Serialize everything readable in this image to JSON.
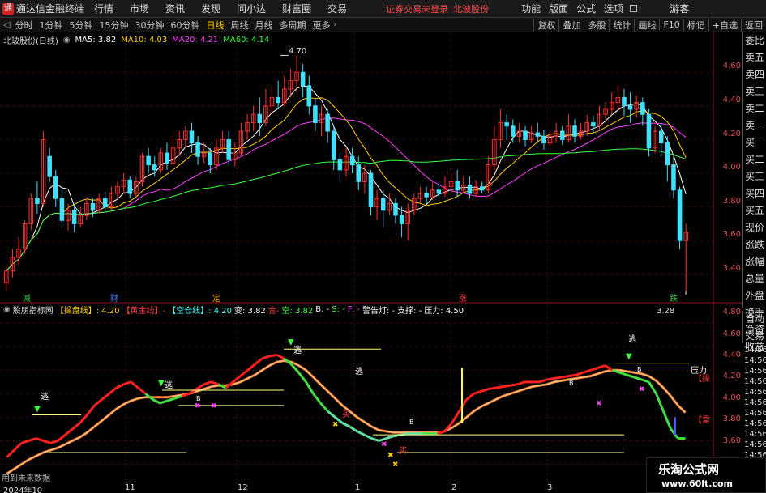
{
  "app": {
    "name": "通达信金融终端",
    "menus": [
      "行情",
      "市场",
      "资讯",
      "发现",
      "问小达",
      "财富圈",
      "交易"
    ],
    "login_notice": "证券交易未登录",
    "stock_name": "北玻股份",
    "right_menus": [
      "功能",
      "版面",
      "公式",
      "选项"
    ],
    "guest": "游客"
  },
  "toolbar": {
    "periods": [
      "分时",
      "1分钟",
      "5分钟",
      "15分钟",
      "30分钟",
      "60分钟",
      "日线",
      "周线",
      "月线",
      "多周期",
      "更多"
    ],
    "active_period": "日线",
    "right_buttons": [
      "复权",
      "叠加",
      "多股",
      "统计",
      "画线",
      "F10",
      "标记",
      "+自选",
      "返回"
    ]
  },
  "main_chart": {
    "title": "北玻股份(日线)",
    "ma_labels": [
      {
        "text": "MA5: 3.82",
        "color": "#ffffff"
      },
      {
        "text": "MA10: 4.03",
        "color": "#ffd000"
      },
      {
        "text": "MA20: 4.21",
        "color": "#ff40ff"
      },
      {
        "text": "MA60: 4.14",
        "color": "#40ff40"
      }
    ],
    "y_ticks": [
      "4.60",
      "4.40",
      "4.20",
      "4.00",
      "3.80",
      "3.60",
      "3.40"
    ],
    "high_label": "4.70",
    "low_label": "3.28",
    "markers": [
      {
        "text": "减",
        "color": "#40c040"
      },
      {
        "text": "财",
        "color": "#4080ff"
      },
      {
        "text": "定",
        "color": "#ffa000"
      },
      {
        "text": "涨",
        "color": "#ff4040"
      },
      {
        "text": "跌",
        "color": "#40c040"
      }
    ]
  },
  "right_panel": [
    "委比",
    "卖五",
    "卖四",
    "卖三",
    "卖二",
    "卖一",
    "买一",
    "买二",
    "买三",
    "买四",
    "买五",
    "现价",
    "涨跌",
    "涨幅",
    "总量",
    "外盘",
    "换手",
    "净资",
    "收益"
  ],
  "right_panel2": [
    "自动",
    "交易"
  ],
  "indicator": {
    "name": "股朋指标网",
    "labels": [
      {
        "text": "【操盘线】: 4.20",
        "color": "#ffd000"
      },
      {
        "text": "【黄金线】-",
        "color": "#ff4040"
      },
      {
        "text": "【空仓线】: 4.20",
        "color": "#40ffff"
      },
      {
        "text": "变: 3.82",
        "color": "#ffffff"
      },
      {
        "text": "金-",
        "color": "#ff4040"
      },
      {
        "text": "空: 3.82",
        "color": "#40ff40"
      },
      {
        "text": "B: -",
        "color": "#ffffff"
      },
      {
        "text": "S: -",
        "color": "#40ff40"
      },
      {
        "text": "F: -",
        "color": "#ff40ff"
      },
      {
        "text": "警告灯: -",
        "color": "#ffffff"
      },
      {
        "text": "支撑: -",
        "color": "#ffffff"
      },
      {
        "text": "压力: 4.50",
        "color": "#ffffff"
      }
    ],
    "y_ticks": [
      "4.80",
      "4.60",
      "4.40",
      "4.20",
      "4.00",
      "3.80",
      "3.60"
    ],
    "right_ticks": [
      "14:56",
      "14:56",
      "14:56",
      "14:56",
      "14:56",
      "14:56",
      "14:56",
      "14:56",
      "14:56",
      "14:56",
      "14:56",
      "14:56"
    ],
    "annotations": {
      "escape": "逃",
      "buy": "买",
      "pressure": "压力",
      "B": "B",
      "cut1": "【操",
      "cut2": "【雷"
    }
  },
  "x_axis": [
    "2024年10",
    "11",
    "12",
    "1",
    "2",
    "3"
  ],
  "no_future": "用到未来数据",
  "watermark": {
    "line1": "乐淘公式网",
    "line2": "www.60lt.com"
  },
  "chart_data": {
    "type": "candlestick",
    "title": "北玻股份(日线)",
    "ylim": [
      3.25,
      4.75
    ],
    "candles": [
      [
        3.35,
        3.42,
        3.3,
        3.45
      ],
      [
        3.42,
        3.5,
        3.38,
        3.55
      ],
      [
        3.5,
        3.55,
        3.46,
        3.62
      ],
      [
        3.55,
        3.7,
        3.52,
        3.72
      ],
      [
        3.7,
        3.85,
        3.66,
        3.88
      ],
      [
        3.85,
        3.82,
        3.76,
        3.95
      ],
      [
        3.82,
        4.2,
        3.8,
        4.25
      ],
      [
        4.1,
        3.98,
        3.95,
        4.15
      ],
      [
        3.98,
        3.85,
        3.8,
        4.02
      ],
      [
        3.85,
        3.72,
        3.68,
        3.9
      ],
      [
        3.72,
        3.78,
        3.66,
        3.82
      ],
      [
        3.78,
        3.7,
        3.65,
        3.82
      ],
      [
        3.7,
        3.75,
        3.68,
        3.8
      ],
      [
        3.75,
        3.82,
        3.72,
        3.86
      ],
      [
        3.82,
        3.78,
        3.74,
        3.85
      ],
      [
        3.78,
        3.85,
        3.76,
        3.88
      ],
      [
        3.85,
        3.8,
        3.77,
        3.89
      ],
      [
        3.8,
        3.88,
        3.78,
        3.92
      ],
      [
        3.88,
        3.92,
        3.85,
        3.95
      ],
      [
        3.92,
        3.96,
        3.88,
        4.0
      ],
      [
        3.96,
        3.88,
        3.85,
        3.98
      ],
      [
        3.88,
        3.95,
        3.86,
        3.98
      ],
      [
        3.95,
        4.1,
        3.92,
        4.12
      ],
      [
        4.1,
        4.05,
        4.0,
        4.15
      ],
      [
        4.05,
        4.02,
        3.98,
        4.1
      ],
      [
        4.02,
        4.12,
        4.0,
        4.15
      ],
      [
        4.12,
        4.06,
        4.02,
        4.18
      ],
      [
        4.06,
        4.15,
        4.04,
        4.2
      ],
      [
        4.15,
        4.2,
        4.1,
        4.25
      ],
      [
        4.2,
        4.25,
        4.15,
        4.28
      ],
      [
        4.25,
        4.18,
        4.12,
        4.3
      ],
      [
        4.18,
        4.1,
        4.05,
        4.22
      ],
      [
        4.1,
        4.12,
        4.06,
        4.18
      ],
      [
        4.12,
        4.05,
        4.0,
        4.15
      ],
      [
        4.05,
        4.15,
        4.02,
        4.2
      ],
      [
        4.15,
        4.2,
        4.12,
        4.25
      ],
      [
        4.2,
        4.08,
        4.05,
        4.25
      ],
      [
        4.08,
        4.12,
        4.04,
        4.18
      ],
      [
        4.12,
        4.25,
        4.1,
        4.3
      ],
      [
        4.25,
        4.3,
        4.2,
        4.35
      ],
      [
        4.3,
        4.35,
        4.25,
        4.4
      ],
      [
        4.35,
        4.3,
        4.22,
        4.45
      ],
      [
        4.3,
        4.4,
        4.28,
        4.5
      ],
      [
        4.4,
        4.45,
        4.35,
        4.52
      ],
      [
        4.45,
        4.42,
        4.38,
        4.55
      ],
      [
        4.42,
        4.5,
        4.4,
        4.58
      ],
      [
        4.5,
        4.55,
        4.45,
        4.62
      ],
      [
        4.55,
        4.6,
        4.48,
        4.7
      ],
      [
        4.6,
        4.52,
        4.45,
        4.65
      ],
      [
        4.52,
        4.4,
        4.35,
        4.58
      ],
      [
        4.4,
        4.3,
        4.25,
        4.45
      ],
      [
        4.3,
        4.35,
        4.22,
        4.4
      ],
      [
        4.35,
        4.25,
        4.18,
        4.38
      ],
      [
        4.25,
        4.08,
        4.02,
        4.28
      ],
      [
        4.08,
        4.02,
        3.95,
        4.12
      ],
      [
        4.02,
        4.1,
        3.98,
        4.15
      ],
      [
        4.1,
        4.05,
        4.0,
        4.15
      ],
      [
        4.05,
        3.95,
        3.9,
        4.1
      ],
      [
        3.95,
        4.0,
        3.88,
        4.05
      ],
      [
        4.0,
        3.8,
        3.75,
        4.02
      ],
      [
        3.8,
        3.85,
        3.72,
        3.9
      ],
      [
        3.85,
        3.78,
        3.68,
        3.9
      ],
      [
        3.78,
        3.82,
        3.75,
        3.88
      ],
      [
        3.82,
        3.75,
        3.7,
        3.85
      ],
      [
        3.75,
        3.7,
        3.62,
        3.8
      ],
      [
        3.7,
        3.78,
        3.6,
        3.82
      ],
      [
        3.78,
        3.85,
        3.75,
        3.88
      ],
      [
        3.85,
        3.88,
        3.82,
        3.92
      ],
      [
        3.88,
        3.86,
        3.82,
        3.92
      ],
      [
        3.86,
        3.9,
        3.84,
        3.95
      ],
      [
        3.9,
        3.88,
        3.85,
        3.94
      ],
      [
        3.88,
        3.92,
        3.86,
        3.98
      ],
      [
        3.92,
        3.95,
        3.88,
        4.0
      ],
      [
        3.95,
        3.9,
        3.86,
        4.02
      ],
      [
        3.9,
        3.93,
        3.88,
        3.98
      ],
      [
        3.93,
        3.88,
        3.85,
        3.98
      ],
      [
        3.88,
        3.92,
        3.86,
        3.96
      ],
      [
        3.92,
        3.9,
        3.88,
        3.95
      ],
      [
        3.9,
        4.05,
        3.88,
        4.1
      ],
      [
        4.05,
        4.2,
        4.02,
        4.28
      ],
      [
        4.2,
        4.3,
        4.15,
        4.38
      ],
      [
        4.3,
        4.28,
        4.2,
        4.35
      ],
      [
        4.28,
        4.22,
        4.18,
        4.32
      ],
      [
        4.22,
        4.25,
        4.18,
        4.3
      ],
      [
        4.25,
        4.2,
        4.16,
        4.28
      ],
      [
        4.2,
        4.24,
        4.18,
        4.28
      ],
      [
        4.24,
        4.22,
        4.18,
        4.3
      ],
      [
        4.22,
        4.18,
        4.14,
        4.26
      ],
      [
        4.18,
        4.22,
        4.16,
        4.25
      ],
      [
        4.22,
        4.25,
        4.18,
        4.3
      ],
      [
        4.25,
        4.2,
        4.17,
        4.28
      ],
      [
        4.2,
        4.28,
        4.18,
        4.35
      ],
      [
        4.28,
        4.22,
        4.18,
        4.32
      ],
      [
        4.22,
        4.25,
        4.2,
        4.3
      ],
      [
        4.25,
        4.3,
        4.22,
        4.35
      ],
      [
        4.3,
        4.28,
        4.24,
        4.34
      ],
      [
        4.28,
        4.35,
        4.25,
        4.4
      ],
      [
        4.35,
        4.38,
        4.3,
        4.42
      ],
      [
        4.38,
        4.42,
        4.35,
        4.48
      ],
      [
        4.42,
        4.45,
        4.38,
        4.52
      ],
      [
        4.45,
        4.4,
        4.34,
        4.5
      ],
      [
        4.4,
        4.38,
        4.3,
        4.48
      ],
      [
        4.38,
        4.42,
        4.33,
        4.46
      ],
      [
        4.42,
        4.35,
        4.28,
        4.45
      ],
      [
        4.35,
        4.15,
        4.1,
        4.38
      ],
      [
        4.15,
        4.25,
        4.12,
        4.28
      ],
      [
        4.25,
        4.18,
        4.1,
        4.3
      ],
      [
        4.18,
        4.05,
        3.95,
        4.22
      ],
      [
        4.05,
        3.9,
        3.85,
        4.1
      ],
      [
        3.9,
        3.6,
        3.55,
        3.92
      ],
      [
        3.6,
        3.65,
        3.28,
        3.7
      ]
    ],
    "ma_series": [
      {
        "name": "MA5",
        "color": "#ffffff"
      },
      {
        "name": "MA10",
        "color": "#ffd000"
      },
      {
        "name": "MA20",
        "color": "#ff40ff"
      },
      {
        "name": "MA60",
        "color": "#40ff40"
      }
    ],
    "indicator_ylim": [
      3.5,
      4.85
    ],
    "indicator_series": {
      "fast": [
        3.66,
        3.72,
        3.78,
        3.8,
        3.82,
        3.8,
        3.78,
        3.8,
        3.85,
        3.9,
        3.95,
        4.02,
        4.1,
        4.15,
        4.2,
        4.25,
        4.28,
        4.3,
        4.25,
        4.2,
        4.15,
        4.12,
        4.14,
        4.16,
        4.18,
        4.2,
        4.24,
        4.28,
        4.3,
        4.28,
        4.25,
        4.3,
        4.35,
        4.4,
        4.45,
        4.5,
        4.52,
        4.53,
        4.5,
        4.45,
        4.38,
        4.3,
        4.2,
        4.12,
        4.05,
        4.0,
        3.95,
        3.92,
        3.88,
        3.85,
        3.82,
        3.8,
        3.82,
        3.84,
        3.85,
        3.86,
        3.86,
        3.86,
        3.86,
        3.86,
        3.88,
        3.95,
        4.05,
        4.15,
        4.2,
        4.22,
        4.24,
        4.25,
        4.26,
        4.27,
        4.28,
        4.3,
        4.3,
        4.3,
        4.32,
        4.33,
        4.34,
        4.35,
        4.36,
        4.38,
        4.4,
        4.42,
        4.44,
        4.4,
        4.38,
        4.36,
        4.34,
        4.32,
        4.3,
        4.2,
        4.05,
        3.9,
        3.82,
        3.82
      ],
      "slow": [
        3.52,
        3.56,
        3.6,
        3.64,
        3.67,
        3.7,
        3.72,
        3.74,
        3.77,
        3.8,
        3.83,
        3.87,
        3.92,
        3.97,
        4.02,
        4.07,
        4.11,
        4.14,
        4.16,
        4.17,
        4.17,
        4.17,
        4.17,
        4.18,
        4.19,
        4.2,
        4.22,
        4.24,
        4.26,
        4.27,
        4.27,
        4.28,
        4.3,
        4.33,
        4.36,
        4.4,
        4.44,
        4.47,
        4.48,
        4.47,
        4.44,
        4.4,
        4.34,
        4.28,
        4.22,
        4.16,
        4.1,
        4.05,
        4.0,
        3.96,
        3.92,
        3.89,
        3.88,
        3.87,
        3.87,
        3.87,
        3.87,
        3.87,
        3.87,
        3.87,
        3.88,
        3.91,
        3.95,
        4.0,
        4.05,
        4.09,
        4.12,
        4.15,
        4.18,
        4.2,
        4.22,
        4.24,
        4.26,
        4.27,
        4.28,
        4.3,
        4.31,
        4.32,
        4.33,
        4.34,
        4.35,
        4.37,
        4.39,
        4.4,
        4.4,
        4.39,
        4.38,
        4.37,
        4.35,
        4.31,
        4.25,
        4.18,
        4.1,
        4.04
      ]
    },
    "x_ticks": [
      "2024年10",
      "11",
      "12",
      "1",
      "2",
      "3"
    ]
  }
}
